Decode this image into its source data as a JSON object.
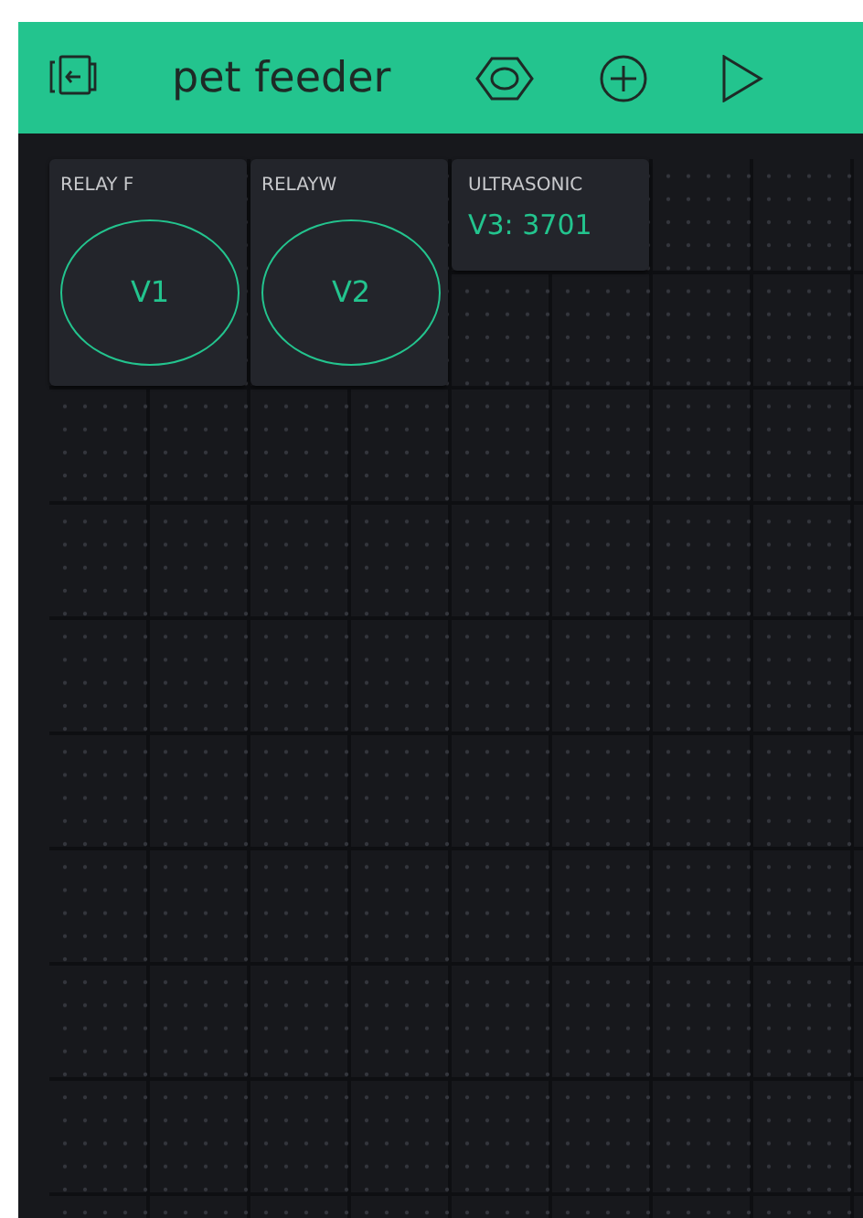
{
  "header": {
    "title": "pet feeder"
  },
  "widgets": [
    {
      "kind": "button",
      "label": "RELAY F",
      "pin": "V1"
    },
    {
      "kind": "button",
      "label": "RELAYW",
      "pin": "V2"
    },
    {
      "kind": "value_display",
      "label": "ULTRASONIC",
      "value": "V3: 3701"
    }
  ]
}
